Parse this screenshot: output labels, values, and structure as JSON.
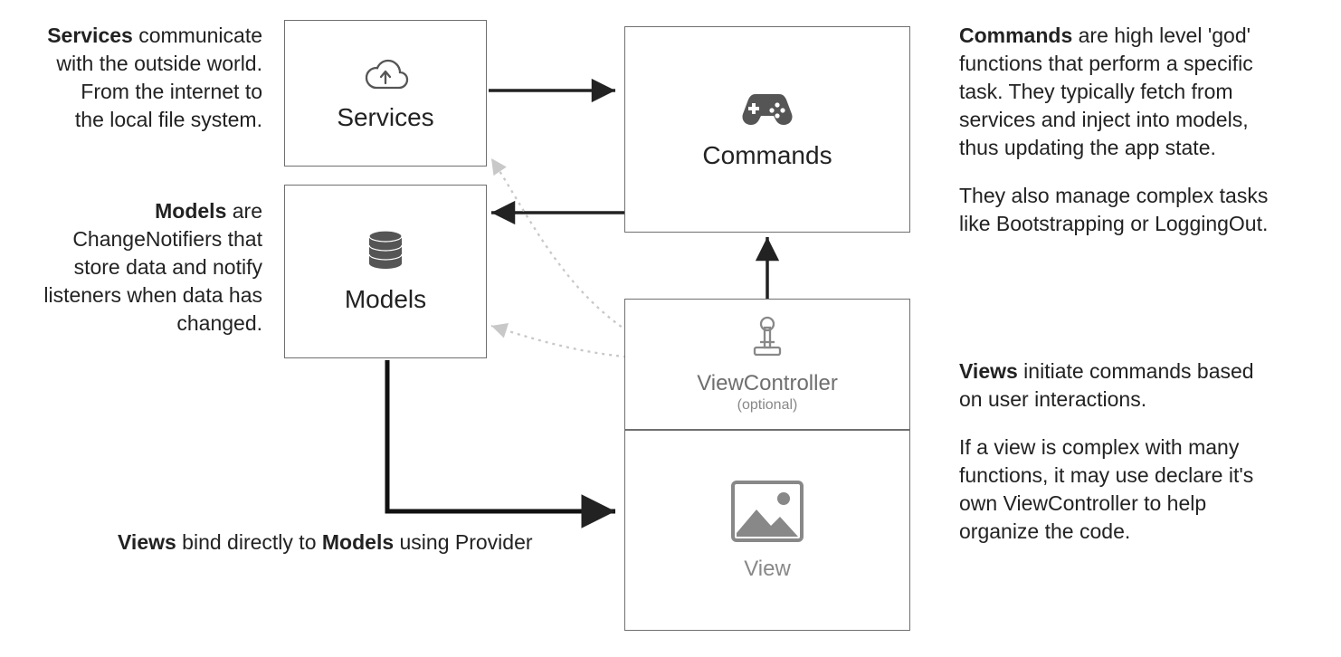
{
  "boxes": {
    "services": {
      "label": "Services"
    },
    "models": {
      "label": "Models"
    },
    "commands": {
      "label": "Commands"
    },
    "viewcontroller": {
      "label": "ViewController",
      "sublabel": "(optional)"
    },
    "view": {
      "label": "View"
    }
  },
  "notes": {
    "services": {
      "bold": "Services",
      "rest1": " communicate",
      "line2": "with the outside world.",
      "line3": "From the internet to",
      "line4": "the local file system."
    },
    "models": {
      "bold": "Models",
      "rest1": " are",
      "line2": "ChangeNotifiers that",
      "line3": "store data and notify",
      "line4": "listeners when data has",
      "line5": "changed."
    },
    "commands": {
      "bold": "Commands",
      "rest1": " are high level 'god'",
      "line2": "functions that perform a specific",
      "line3": "task. They typically fetch from",
      "line4": "services and inject into models,",
      "line5": "thus updating the app state.",
      "para2_line1": "They also manage complex tasks",
      "para2_line2": "like Bootstrapping or LoggingOut."
    },
    "views": {
      "bold": "Views",
      "rest1": " initiate commands based",
      "line2": "on user interactions.",
      "para2_line1": "If a view is complex with many",
      "para2_line2": "functions, it may use declare it's",
      "para2_line3": "own ViewController to help",
      "para2_line4": "organize the code."
    }
  },
  "caption": {
    "bold1": "Views",
    "mid": " bind directly to ",
    "bold2": "Models",
    "rest": " using Provider"
  }
}
